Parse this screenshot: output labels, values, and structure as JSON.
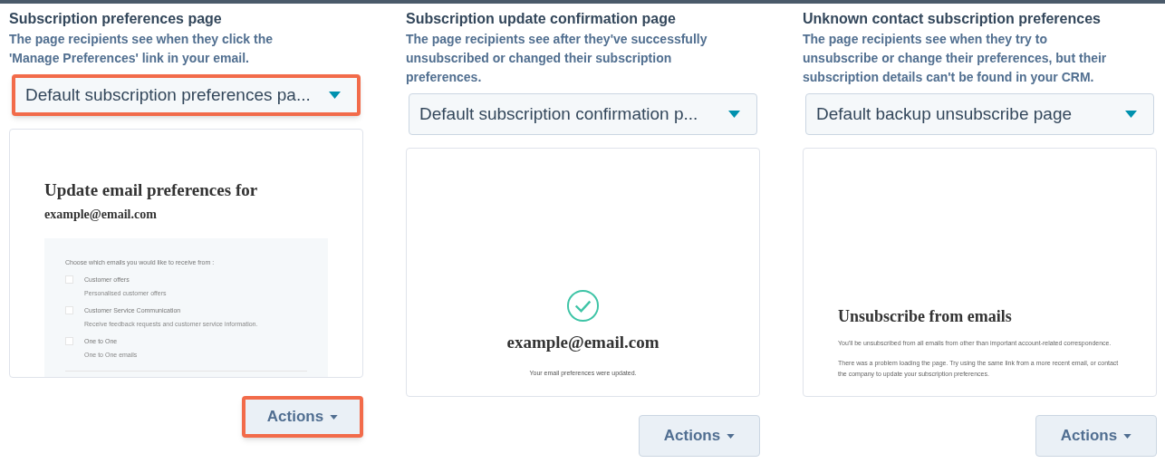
{
  "columns": [
    {
      "title": "Subscription preferences page",
      "description": "The page recipients see when they click the 'Manage Preferences' link in your email.",
      "dropdown": {
        "value": "Default subscription preferences pa...",
        "highlighted": true
      },
      "preview": {
        "kind": "preferences",
        "heading": "Update email preferences for",
        "email": "example@email.com",
        "prompt": "Choose which emails you would like to receive from :",
        "options": [
          {
            "label": "Customer offers",
            "description": "Personalised customer offers",
            "checked": false
          },
          {
            "label": "Customer Service Communication",
            "description": "Receive feedback requests and customer service information.",
            "checked": false
          },
          {
            "label": "One to One",
            "description": "One to One emails",
            "checked": false
          }
        ]
      },
      "actions": {
        "label": "Actions",
        "highlighted": true
      }
    },
    {
      "title": "Subscription update confirmation page",
      "description": "The page recipients see after they've successfully unsubscribed or changed their subscription preferences.",
      "dropdown": {
        "value": "Default subscription confirmation p...",
        "highlighted": false
      },
      "preview": {
        "kind": "confirmation",
        "email": "example@email.com",
        "message": "Your email preferences were updated."
      },
      "actions": {
        "label": "Actions",
        "highlighted": false
      }
    },
    {
      "title": "Unknown contact subscription preferences",
      "description": "The page recipients see when they try to unsubscribe or change their preferences, but their subscription details can't be found in your CRM.",
      "dropdown": {
        "value": "Default backup unsubscribe page",
        "highlighted": false
      },
      "preview": {
        "kind": "unsubscribe",
        "heading": "Unsubscribe from emails",
        "paragraphs": [
          "You'll be unsubscribed from all emails from other than important account-related correspondence.",
          "There was a problem loading the page. Try using the same link from a more recent email, or contact the company to update your subscription preferences."
        ]
      },
      "actions": {
        "label": "Actions",
        "highlighted": false
      }
    }
  ]
}
